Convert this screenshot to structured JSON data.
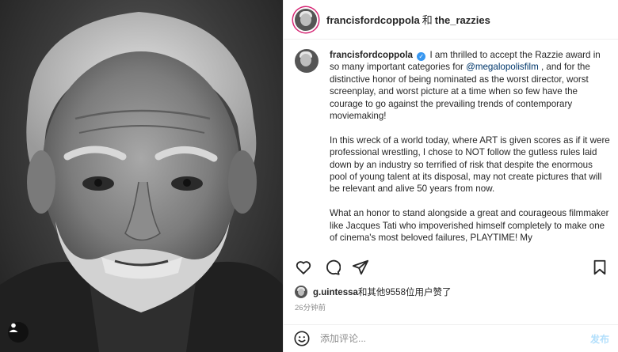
{
  "photo": {
    "alt_icon": "user-tag-icon"
  },
  "header": {
    "user1": "francisfordcoppola",
    "conjunction": "和",
    "user2": "the_razzies"
  },
  "caption": {
    "username": "francisfordcoppola",
    "paragraph1_before_mention": "I am thrilled to accept the Razzie award in so many important categories for ",
    "mention": "@megalopolisfilm",
    "paragraph1_after_mention": " , and for the distinctive honor of being nominated as the worst director, worst screenplay, and worst picture at a time when so few have the courage to go against the prevailing trends of contemporary moviemaking!",
    "paragraph2": "In this wreck of a world today, where ART is given scores as if it were professional wrestling, I chose to NOT follow the gutless rules laid down by an industry so terrified of risk that despite the enormous pool of young talent at its disposal, may not create pictures that will be relevant and alive 50 years from now.",
    "paragraph3": "What an honor to stand alongside a great and courageous filmmaker like Jacques Tati who impoverished himself completely to make one of cinema's most beloved failures, PLAYTIME! My"
  },
  "actions": {
    "like": "heart-icon",
    "comment": "comment-icon",
    "share": "share-icon",
    "save": "bookmark-icon"
  },
  "likes": {
    "liker": "g.uintessa",
    "text": "和其他9558位用户赞了"
  },
  "time": "26分钟前",
  "comment_bar": {
    "placeholder": "添加评论...",
    "post_label": "发布"
  }
}
